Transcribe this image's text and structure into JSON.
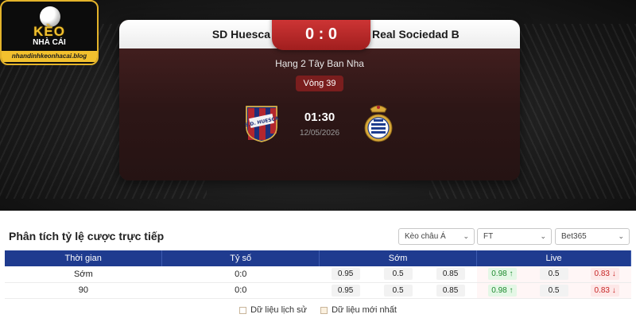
{
  "brand": {
    "name_line1": "KÈO",
    "name_line2": "NHÀ CÁI",
    "url": "nhandinhkeonhacai.blog"
  },
  "match": {
    "home_team": "SD Huesca",
    "away_team": "Real Sociedad B",
    "score": "0 : 0",
    "league": "Hạng 2 Tây Ban Nha",
    "round": "Vòng 39",
    "time": "01:30",
    "date": "12/05/2026",
    "home_crest_text": "S.D. HUESCA"
  },
  "odds_panel": {
    "title": "Phân tích tỷ lệ cược trực tiếp",
    "filters": {
      "market": "Kèo châu Á",
      "period": "FT",
      "bookmaker": "Bet365"
    },
    "columns": [
      "Thời gian",
      "Tỷ số",
      "Sớm",
      "Live"
    ],
    "rows": [
      {
        "time": "Sớm",
        "score": "0:0",
        "early": [
          "0.95",
          "0.5",
          "0.85"
        ],
        "live": [
          "0.98",
          "0.5",
          "0.83"
        ]
      },
      {
        "time": "90",
        "score": "0:0",
        "early": [
          "0.95",
          "0.5",
          "0.85"
        ],
        "live": [
          "0.98",
          "0.5",
          "0.83"
        ]
      }
    ],
    "legend": {
      "history": "Dữ liệu lịch sử",
      "latest": "Dữ liệu mới nhất"
    }
  },
  "colors": {
    "accent_red": "#c42a2a",
    "table_header": "#1f3b8f",
    "brand_gold": "#f2c12e",
    "odds_up": "#1d8a2e",
    "odds_down": "#c72424"
  }
}
